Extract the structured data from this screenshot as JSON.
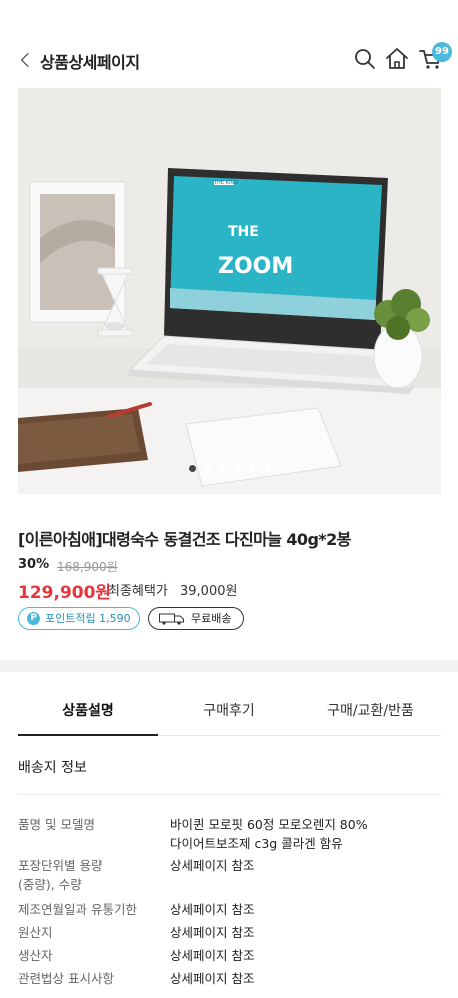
{
  "header": {
    "title": "상품상세페이지",
    "cart_count": "99",
    "icons": [
      "search-icon",
      "home-icon",
      "cart-icon"
    ]
  },
  "image": {
    "screen_brand": "THE KIND",
    "screen_title_1": "THE",
    "screen_title_2": "ZOOM",
    "dot_count": 6,
    "active_dot": 1
  },
  "product": {
    "name": "[이른아침애]대령숙수 동결건조 다진마늘 40g*2봉",
    "discount_rate": "30%",
    "original_price": "168,900원",
    "sale_price": "129,900원",
    "benefit_label": "최종혜택가",
    "benefit_value": "39,000원",
    "point_badge": "포인트적립 1,590",
    "shipping_badge": "무료배송"
  },
  "tabs": [
    {
      "label": "상품설명",
      "active": true
    },
    {
      "label": "구매후기",
      "active": false
    },
    {
      "label": "구매/교환/반품",
      "active": false
    }
  ],
  "section": {
    "title": "배송지 정보"
  },
  "info_rows": [
    {
      "label": "품명 및 모델명",
      "value_line1": "바이퀸 모로핏 60정 모로오렌지 80%",
      "value_line2": "다이어트보조제 c3g 콜라겐 함유"
    },
    {
      "label_line1": "포장단위별 용량",
      "label_line2": "(중량), 수량",
      "value": "상세페이지 참조"
    },
    {
      "label": "제조연월일과 유통기한",
      "value": "상세페이지 참조"
    },
    {
      "label": "원산지",
      "value": "상세페이지 참조"
    },
    {
      "label": "생산자",
      "value": "상세페이지 참조"
    },
    {
      "label": "관련법상 표시사항",
      "value": "상세페이지 참조"
    }
  ],
  "colors": {
    "accent_blue": "#4bb8dc",
    "price_red": "#e8353b"
  }
}
